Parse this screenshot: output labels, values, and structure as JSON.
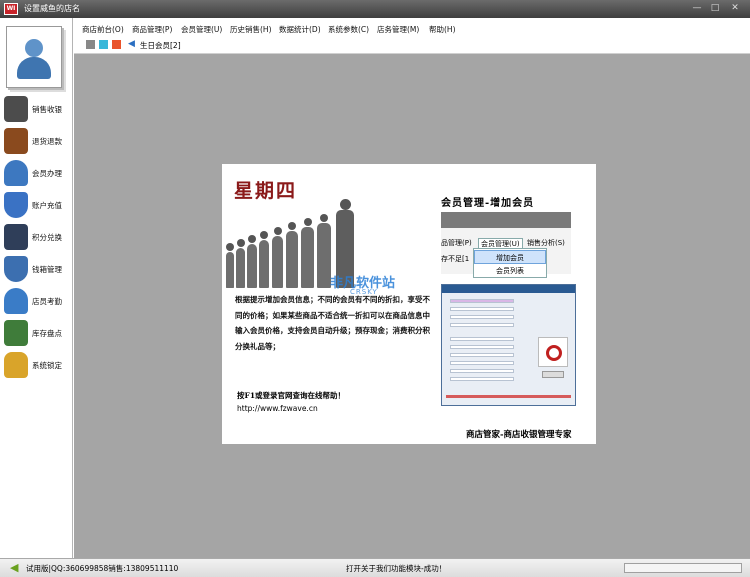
{
  "window": {
    "title": "设置威鱼的店名",
    "app_icon_text": "WI",
    "buttons": [
      "—",
      "□",
      "✕"
    ]
  },
  "sidebar": {
    "items": [
      {
        "label": "销售收银",
        "icon": "cash-register-icon",
        "color": "#4c4c4c"
      },
      {
        "label": "退货退款",
        "icon": "wallet-icon",
        "color": "#8a4a1e"
      },
      {
        "label": "会员办理",
        "icon": "member-icon",
        "color": "#3d78c0"
      },
      {
        "label": "账户充值",
        "icon": "shield-icon",
        "color": "#3a72c4"
      },
      {
        "label": "积分兑换",
        "icon": "exchange-icon",
        "color": "#2f3e59"
      },
      {
        "label": "钱箱管理",
        "icon": "shield-check-icon",
        "color": "#3c6fb0"
      },
      {
        "label": "店员考勤",
        "icon": "staff-icon",
        "color": "#3a7cc7"
      },
      {
        "label": "库存盘点",
        "icon": "inventory-icon",
        "color": "#3f7c3a"
      },
      {
        "label": "系统锁定",
        "icon": "lock-icon",
        "color": "#d9a42a"
      }
    ]
  },
  "menu": {
    "items": [
      "商店前台(O)",
      "商品管理(P)",
      "会员管理(U)",
      "历史销售(H)",
      "数据统计(D)",
      "系统参数(C)",
      "店务管理(M)",
      "帮助(H)"
    ],
    "swatches": [
      "#888888",
      "#39b7d9",
      "#e9542c"
    ],
    "birthday_label": "生日会员[2]"
  },
  "splash": {
    "weekday": "星期四",
    "watermark": "非凡软件站",
    "watermark_sub": "CRSKY",
    "paragraph": "根据提示增加会员信息；不同的会员有不同的折扣，享受不同的价格；如果某些商品不适合统一折扣可以在商品信息中输入会员价格，支持会员自动升级；预存现金；消费积分积分换礼品等；",
    "f1_tip": "按F1或登录官网查询在线帮助！",
    "url": "http://www.fzwave.cn",
    "feature_title": "会员管理-增加会员",
    "slogan": "商店管家-商店收银管理专家",
    "preview": {
      "menu": [
        "品管理(P)",
        "会员管理(U)",
        "销售分析(S)"
      ],
      "dropdown": [
        "增加会员",
        "会员列表"
      ],
      "stock_text": "存不足[1"
    }
  },
  "status": {
    "left": "试用版|QQ:360699858销售:13809511110",
    "middle": "打开关于我们功能模块-成功！"
  }
}
